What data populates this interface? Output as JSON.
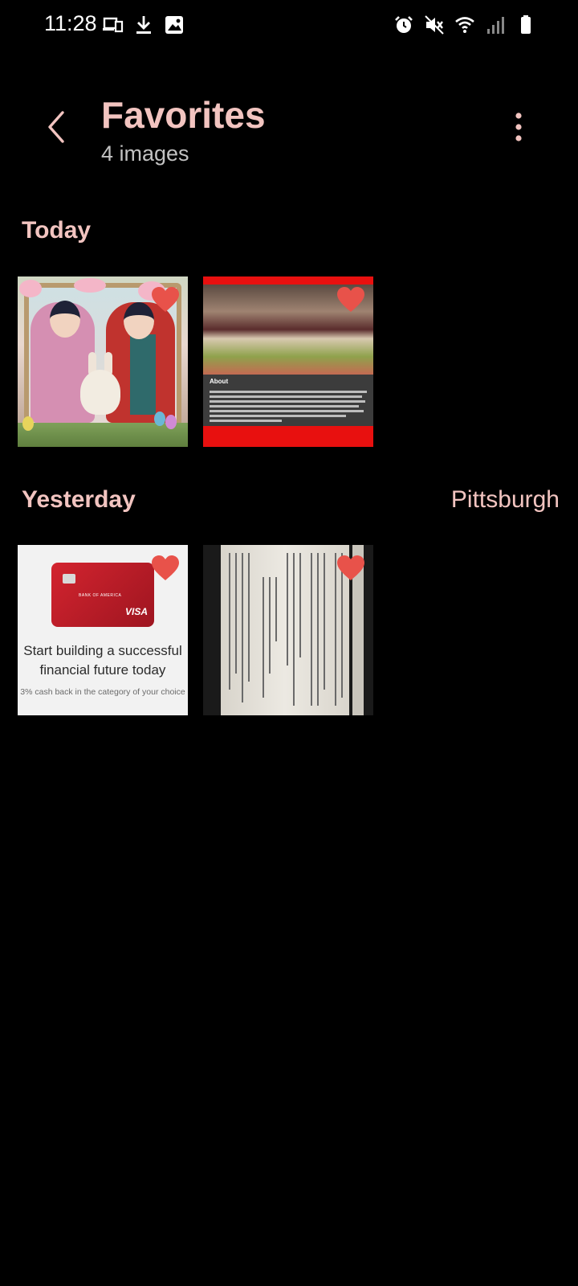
{
  "status_bar": {
    "time": "11:28",
    "left_icons": [
      "cast-icon",
      "download-icon",
      "gallery-icon"
    ],
    "right_icons": [
      "alarm-icon",
      "mute-icon",
      "wifi-icon",
      "signal-icon",
      "battery-icon"
    ]
  },
  "header": {
    "title": "Favorites",
    "subtitle": "4 images"
  },
  "sections": [
    {
      "label": "Today",
      "location": "",
      "items": [
        {
          "type": "image",
          "favorite": true,
          "icon": "illustration-thumbnail"
        },
        {
          "type": "image",
          "favorite": true,
          "icon": "sandwich-webpage-thumbnail",
          "about_label": "About"
        }
      ]
    },
    {
      "label": "Yesterday",
      "location": "Pittsburgh",
      "items": [
        {
          "type": "image",
          "favorite": true,
          "icon": "credit-card-ad-thumbnail",
          "card_bank": "BANK OF AMERICA",
          "card_brand": "VISA",
          "headline": "Start building a successful financial future today",
          "subtext": "3% cash back in the category of your choice"
        },
        {
          "type": "image",
          "favorite": true,
          "icon": "document-thumbnail"
        }
      ]
    }
  ],
  "colors": {
    "accent": "#f2c4c0",
    "heart": "#e8524a",
    "background": "#000000"
  }
}
